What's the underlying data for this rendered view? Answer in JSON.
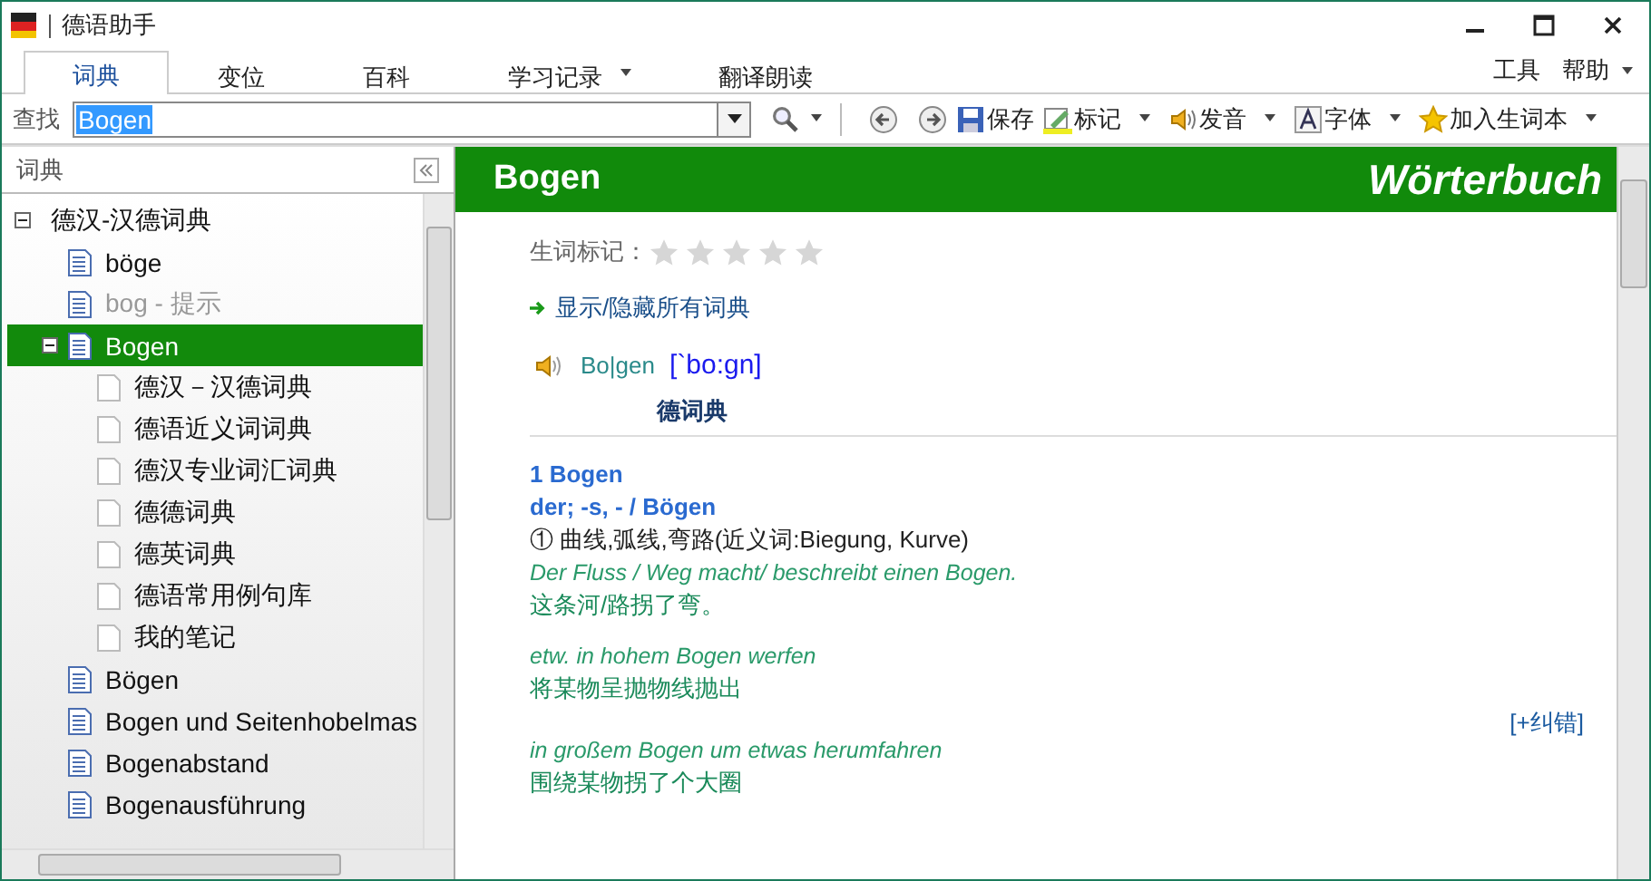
{
  "window": {
    "title": "德语助手"
  },
  "tabs": [
    {
      "label": "词典",
      "selected": true,
      "dropdown": false
    },
    {
      "label": "变位",
      "selected": false,
      "dropdown": false
    },
    {
      "label": "百科",
      "selected": false,
      "dropdown": false
    },
    {
      "label": "学习记录",
      "selected": false,
      "dropdown": true
    },
    {
      "label": "翻译朗读",
      "selected": false,
      "dropdown": false
    }
  ],
  "menus": [
    {
      "label": "工具"
    },
    {
      "label": "帮助"
    }
  ],
  "toolbar": {
    "search_label": "查找",
    "search_value": "Bogen",
    "buttons": [
      {
        "kind": "save",
        "label": "保存",
        "dropdown": false
      },
      {
        "kind": "mark",
        "label": "标记",
        "dropdown": true
      },
      {
        "kind": "speak",
        "label": "发音",
        "dropdown": true
      },
      {
        "kind": "font",
        "label": "字体",
        "dropdown": true
      },
      {
        "kind": "star",
        "label": "加入生词本",
        "dropdown": true
      }
    ]
  },
  "sidebar": {
    "title": "词典",
    "tree": [
      {
        "label": "德汉-汉德词典",
        "expanded": true,
        "selected": false,
        "children": [
          {
            "label": "böge",
            "kind": "word",
            "selected": false
          },
          {
            "label": "bog - 提示",
            "kind": "hint",
            "selected": false
          },
          {
            "label": "Bogen",
            "kind": "word",
            "expanded": true,
            "selected": true,
            "children": [
              {
                "label": "德汉－汉德词典",
                "kind": "dict",
                "selected": false
              },
              {
                "label": "德语近义词词典",
                "kind": "dict",
                "selected": false
              },
              {
                "label": "德汉专业词汇词典",
                "kind": "dict",
                "selected": false
              },
              {
                "label": "德德词典",
                "kind": "dict",
                "selected": false
              },
              {
                "label": "德英词典",
                "kind": "dict",
                "selected": false
              },
              {
                "label": "德语常用例句库",
                "kind": "dict",
                "selected": false
              },
              {
                "label": "我的笔记",
                "kind": "dict",
                "selected": false
              }
            ]
          },
          {
            "label": "Bögen",
            "kind": "word",
            "selected": false
          },
          {
            "label": "Bogen und Seitenhobelmas",
            "kind": "word",
            "selected": false
          },
          {
            "label": "Bogenabstand",
            "kind": "word",
            "selected": false
          },
          {
            "label": "Bogenausführung",
            "kind": "word",
            "selected": false
          }
        ]
      }
    ]
  },
  "entry": {
    "word": "Bogen",
    "banner": "Wörterbuch",
    "star_label": "生词标记：",
    "stars": 0,
    "toggle_link": "显示/隐藏所有词典",
    "headword": "Bo|gen",
    "phonetic": "[`bo:gn]",
    "section_title": "德词典",
    "sense_title": "1 Bogen",
    "grammar": "der; -s, - / Bögen",
    "definition": "①  曲线,弧线,弯路(近义词:Biegung, Kurve)",
    "blocks": [
      {
        "kind": "example",
        "de": "Der Fluss / Weg macht/ beschreibt einen Bogen.",
        "zh": "这条河/路拐了弯。"
      },
      {
        "kind": "example",
        "de": "etw. in hohem Bogen werfen",
        "zh": "将某物呈抛物线抛出"
      },
      {
        "kind": "correction",
        "label": "[+纠错]"
      },
      {
        "kind": "example",
        "de": "in großem Bogen um etwas herumfahren",
        "zh": "围绕某物拐了个大圈"
      }
    ]
  }
}
